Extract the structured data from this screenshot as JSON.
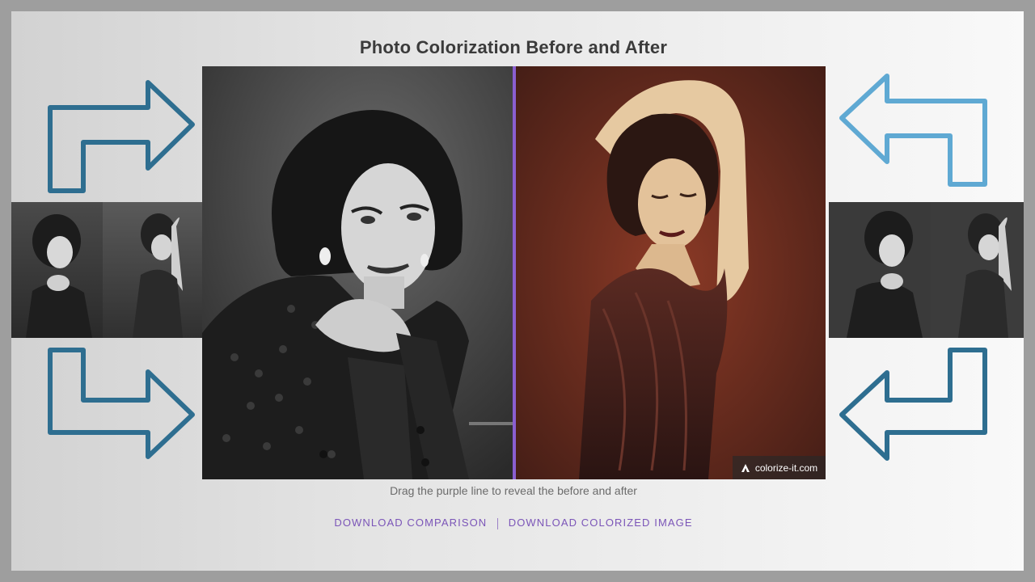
{
  "title": "Photo Colorization Before and After",
  "caption": "Drag the purple line to reveal the before and after",
  "watermark": "colorize-it.com",
  "links": {
    "download_comparison": "DOWNLOAD COMPARISON",
    "download_colorized": "DOWNLOAD COLORIZED IMAGE"
  },
  "slider": {
    "position_percent": 50
  },
  "colors": {
    "divider": "#8a5fd0",
    "arrow_dark": "#2e6e90",
    "arrow_light": "#5fa9d3",
    "link": "#7b55b8"
  },
  "icons": [
    "arrow-right-icon",
    "arrow-left-icon",
    "colorize-logo-icon"
  ]
}
